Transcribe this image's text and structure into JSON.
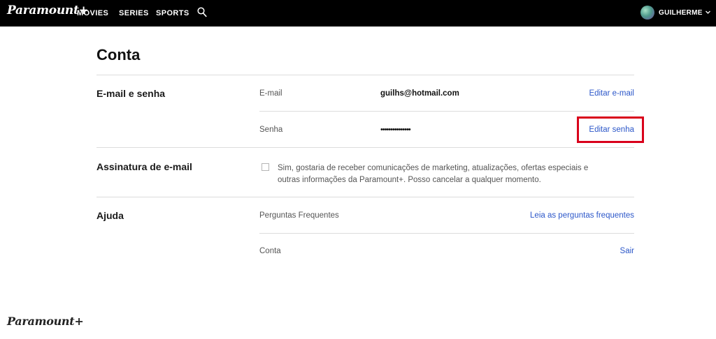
{
  "header": {
    "brand": "Paramount+",
    "nav": [
      "MOVIES",
      "SERIES",
      "SPORTS"
    ],
    "search_icon": "search-icon",
    "user_name": "GUILHERME",
    "user_menu_icon": "chevron-down-icon"
  },
  "page": {
    "title": "Conta"
  },
  "sections": {
    "email_password": {
      "title": "E-mail e senha",
      "email_label": "E-mail",
      "email_value": "guilhs@hotmail.com",
      "email_action": "Editar e-mail",
      "password_label": "Senha",
      "password_value": "•••••••••••••••",
      "password_action": "Editar senha"
    },
    "newsletter": {
      "title": "Assinatura de e-mail",
      "consent_checked": false,
      "consent_text": "Sim, gostaria de receber comunicações de marketing, atualizações, ofertas especiais e outras informações da Paramount+. Posso cancelar a qualquer momento."
    },
    "help": {
      "title": "Ajuda",
      "faq_label": "Perguntas Frequentes",
      "faq_action": "Leia as perguntas frequentes",
      "account_label": "Conta",
      "account_action": "Sair"
    }
  },
  "footer": {
    "brand": "Paramount+"
  },
  "colors": {
    "header_bg": "#000000",
    "link": "#2c57c9",
    "highlight": "#d9001b"
  }
}
